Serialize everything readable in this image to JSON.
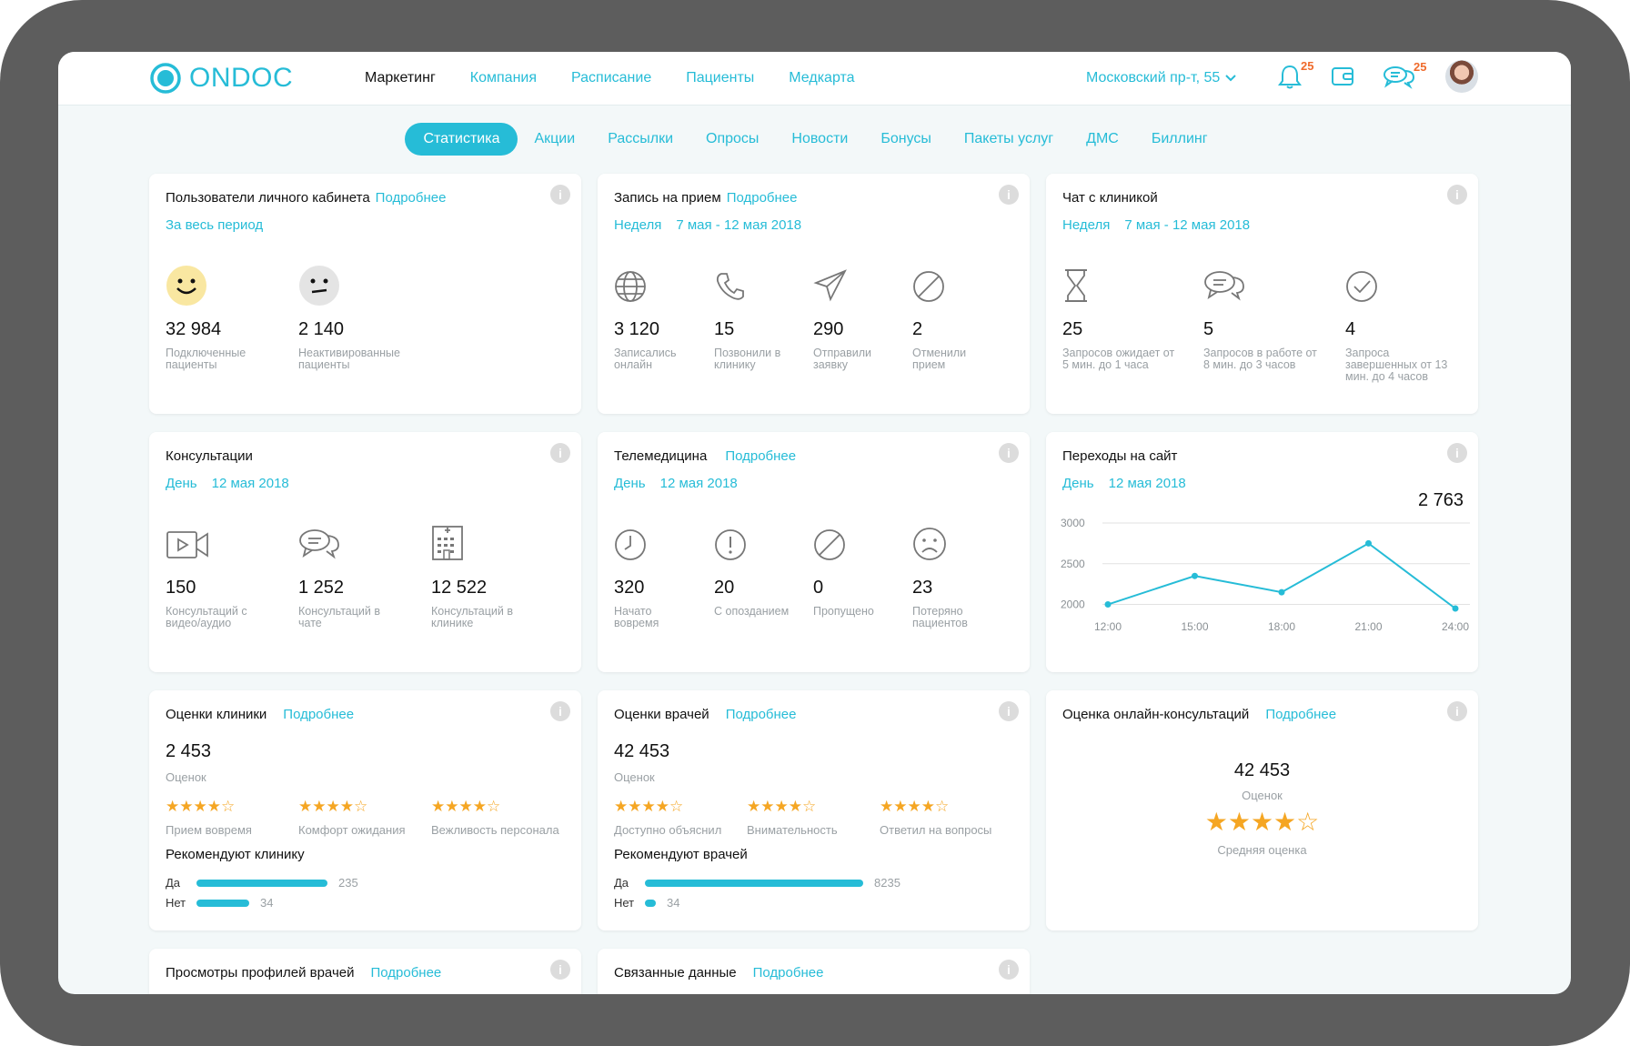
{
  "app": {
    "logo": "ONDOC",
    "nav": [
      "Маркетинг",
      "Компания",
      "Расписание",
      "Пациенты",
      "Медкарта"
    ],
    "branch": "Московский пр-т, 55",
    "notifications": "25",
    "messages": "25"
  },
  "subnav": [
    "Статистика",
    "Акции",
    "Рассылки",
    "Опросы",
    "Новости",
    "Бонусы",
    "Пакеты услуг",
    "ДМС",
    "Биллинг"
  ],
  "colors": {
    "accent": "#26bcd7",
    "star": "#f5a623",
    "badge": "#ef6a2b"
  },
  "users": {
    "title": "Пользователи личного кабинета",
    "more": "Подробнее",
    "period": "За весь период",
    "stats": [
      {
        "icon": "smile-face-icon",
        "value": "32 984",
        "label": "Подключенные пациенты"
      },
      {
        "icon": "neutral-face-icon",
        "value": "2 140",
        "label": "Неактивированные пациенты"
      }
    ]
  },
  "booking": {
    "title": "Запись на прием",
    "more": "Подробнее",
    "period": "Неделя",
    "dates": "7 мая - 12 мая 2018",
    "stats": [
      {
        "icon": "globe-icon",
        "value": "3 120",
        "label": "Записались онлайн"
      },
      {
        "icon": "phone-icon",
        "value": "15",
        "label": "Позвонили в клинику"
      },
      {
        "icon": "paper-plane-icon",
        "value": "290",
        "label": "Отправили заявку"
      },
      {
        "icon": "cancel-icon",
        "value": "2",
        "label": "Отменили прием"
      }
    ]
  },
  "chat": {
    "title": "Чат с клиникой",
    "period": "Неделя",
    "dates": "7 мая - 12 мая 2018",
    "stats": [
      {
        "icon": "hourglass-icon",
        "value": "25",
        "label": "Запросов ожидает от 5 мин. до 1 часа"
      },
      {
        "icon": "chat-bubbles-icon",
        "value": "5",
        "label": "Запросов в работе от 8 мин. до 3 часов"
      },
      {
        "icon": "check-circle-icon",
        "value": "4",
        "label": "Запроса завершенных от 13 мин. до 4 часов"
      }
    ]
  },
  "consult": {
    "title": "Консультации",
    "period": "День",
    "dates": "12 мая 2018",
    "stats": [
      {
        "icon": "video-icon",
        "value": "150",
        "label": "Консультаций с видео/аудио"
      },
      {
        "icon": "chat-bubbles-icon",
        "value": "1 252",
        "label": "Консультаций в чате"
      },
      {
        "icon": "clinic-building-icon",
        "value": "12 522",
        "label": "Консультаций в клинике"
      }
    ]
  },
  "tele": {
    "title": "Телемедицина",
    "more": "Подробнее",
    "period": "День",
    "dates": "12 мая 2018",
    "stats": [
      {
        "icon": "clock-icon",
        "value": "320",
        "label": "Начато вовремя"
      },
      {
        "icon": "alert-icon",
        "value": "20",
        "label": "С опозданием"
      },
      {
        "icon": "cancel-icon",
        "value": "0",
        "label": "Пропущено"
      },
      {
        "icon": "sad-face-icon",
        "value": "23",
        "label": "Потеряно пациентов"
      }
    ]
  },
  "visits": {
    "title": "Переходы на сайт",
    "period": "День",
    "dates": "12 мая 2018",
    "total": "2 763"
  },
  "chart_data": {
    "type": "line",
    "x": [
      "12:00",
      "15:00",
      "18:00",
      "21:00",
      "24:00"
    ],
    "series": [
      {
        "values": [
          2000,
          2350,
          2150,
          2750,
          1950
        ]
      }
    ],
    "yticks": [
      "3000",
      "2500",
      "2000"
    ],
    "ylim": [
      1800,
      3000
    ],
    "grid": true
  },
  "clinicRatings": {
    "title": "Оценки клиники",
    "more": "Подробнее",
    "count": "2 453",
    "countLabel": "Оценок",
    "criteria": [
      {
        "stars": 4,
        "label": "Прием вовремя"
      },
      {
        "stars": 4,
        "label": "Комфорт ожидания"
      },
      {
        "stars": 4,
        "label": "Вежливость персонала"
      }
    ],
    "recommend": "Рекомендуют клинику",
    "yes": "Да",
    "yesVal": "235",
    "yesFrac": 0.6,
    "no": "Нет",
    "noVal": "34",
    "noFrac": 0.24
  },
  "doctorRatings": {
    "title": "Оценки врачей",
    "more": "Подробнее",
    "count": "42 453",
    "countLabel": "Оценок",
    "criteria": [
      {
        "stars": 4,
        "label": "Доступно объяснил"
      },
      {
        "stars": 4,
        "label": "Внимательность"
      },
      {
        "stars": 4,
        "label": "Ответил на вопросы"
      }
    ],
    "recommend": "Рекомендуют врачей",
    "yes": "Да",
    "yesVal": "8235",
    "yesFrac": 1.0,
    "no": "Нет",
    "noVal": "34",
    "noFrac": 0.05
  },
  "onlineRating": {
    "title": "Оценка онлайн-консультаций",
    "more": "Подробнее",
    "count": "42 453",
    "countLabel": "Оценок",
    "stars": 4,
    "avgLabel": "Средняя оценка"
  },
  "profiles": {
    "title": "Просмотры профилей врачей",
    "more": "Подробнее"
  },
  "linked": {
    "title": "Связанные данные",
    "more": "Подробнее"
  },
  "info": "i"
}
